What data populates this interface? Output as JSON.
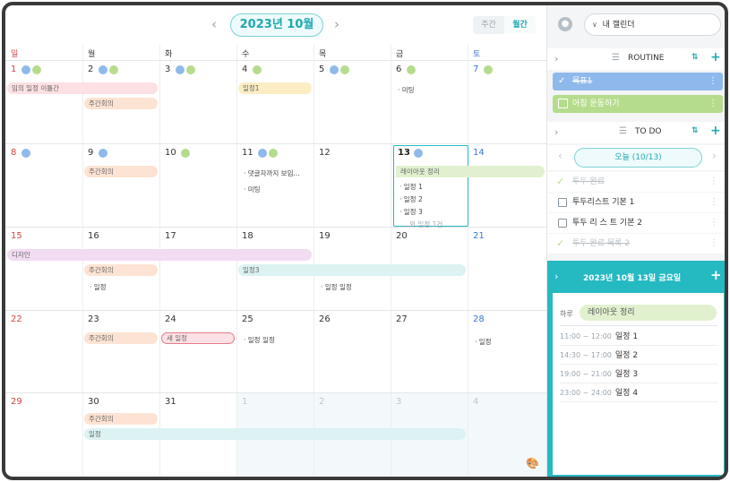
{
  "header": {
    "month_label": "2023년  10월",
    "view_week": "주간",
    "view_month": "월간"
  },
  "weekdays": [
    "일",
    "월",
    "화",
    "수",
    "목",
    "금",
    "토"
  ],
  "weeks": [
    {
      "days": [
        "1",
        "2",
        "3",
        "4",
        "5",
        "6",
        "7"
      ]
    },
    {
      "days": [
        "8",
        "9",
        "10",
        "11",
        "12",
        "13",
        "14"
      ]
    },
    {
      "days": [
        "15",
        "16",
        "17",
        "18",
        "19",
        "20",
        "21"
      ]
    },
    {
      "days": [
        "22",
        "23",
        "24",
        "25",
        "26",
        "27",
        "28"
      ]
    },
    {
      "days": [
        "29",
        "30",
        "31",
        "1",
        "2",
        "3",
        "4"
      ]
    }
  ],
  "events": {
    "w1_multi": "임의 일정 이틀간",
    "w1_meeting_mon": "주간회의",
    "w1_wed": "일정1",
    "w1_fri": "미팅",
    "w2_meeting_mon": "주간회의",
    "w2_wed_1": "댓글자까지 보임...",
    "w2_wed_2": "미팅",
    "w2_layout": "레이아웃 정리",
    "w2_fri_1": "일정 1",
    "w2_fri_2": "일정 2",
    "w2_fri_3": "일정 3",
    "w2_fri_more": "...외 일정 1건",
    "w3_design": "디자인",
    "w3_meeting_mon": "주간회의",
    "w3_wed3": "일정3",
    "w3_mon_item": "일정",
    "w3_thu_item": "일정 일정",
    "w4_meeting_mon": "주간회의",
    "w4_new": "새 일정",
    "w4_wed_item": "일정 일정",
    "w4_sat_item": "일정",
    "w5_meeting_mon": "주간회의",
    "w5_long": "일정"
  },
  "side": {
    "calendar_select": "내 캘린더",
    "routine_title": "ROUTINE",
    "routine_items": [
      "목표1",
      "아침 운동하기"
    ],
    "todo_title": "TO DO",
    "date_pill": "오늘 (10/13)",
    "todos": [
      "투두 완료",
      "투두리스트 기본 1",
      "투두 리 스 트 기본 2",
      "투두 완료 목록 2"
    ],
    "day_title": "2023년  10월  13일  금요일",
    "allday_label": "하루",
    "allday_event": "레이아웃 정리",
    "timeline": [
      {
        "time": "11:00 ~ 12:00",
        "title": "일정 1"
      },
      {
        "time": "14:30 ~ 17:00",
        "title": "일정 2"
      },
      {
        "time": "19:00 ~ 21:00",
        "title": "일정 3"
      },
      {
        "time": "23:00 ~ 24:00",
        "title": "일정 4"
      }
    ]
  },
  "colors": {
    "accent": "#25b9c2",
    "blue_dot": "#8fb9ec",
    "green_dot": "#b5dc8c",
    "sunday": "#d64545",
    "saturday": "#3a78d6"
  }
}
